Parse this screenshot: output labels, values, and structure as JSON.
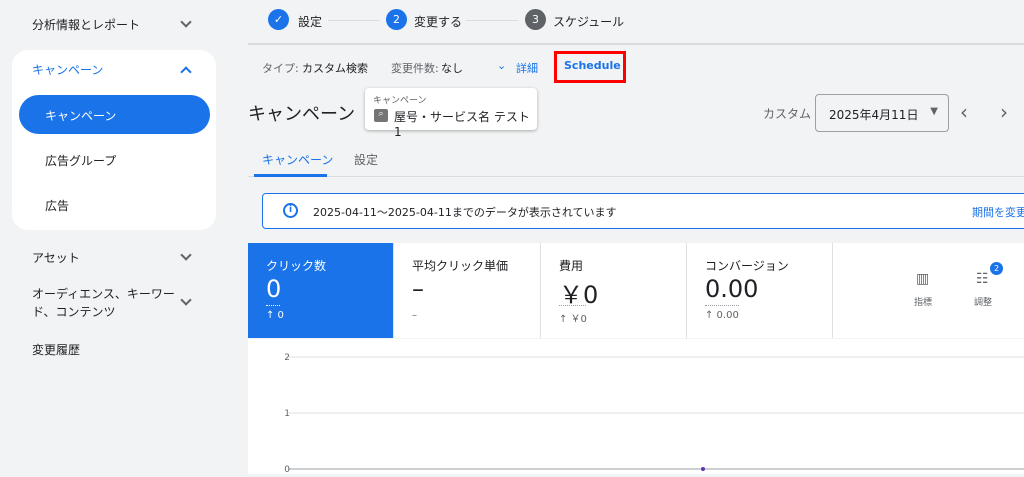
{
  "sidebar": {
    "items": [
      {
        "label": "分析情報とレポート"
      },
      {
        "label": "キャンペーン"
      },
      {
        "label": "キャンペーン",
        "selected": true
      },
      {
        "label": "広告グループ"
      },
      {
        "label": "広告"
      },
      {
        "label": "アセット"
      },
      {
        "label": "オーディエンス、キーワード、コンテンツ"
      },
      {
        "label": "変更履歴"
      }
    ]
  },
  "stepper": {
    "steps": [
      {
        "num": "✓",
        "label": "設定",
        "state": "done"
      },
      {
        "num": "2",
        "label": "変更する",
        "state": "active"
      },
      {
        "num": "3",
        "label": "スケジュール",
        "state": "pending"
      }
    ]
  },
  "infobar": {
    "type_label": "タイプ:",
    "type_value": "カスタム検索",
    "changes_label": "変更件数:",
    "changes_value": "なし",
    "details": "詳細",
    "schedule": "Schedule"
  },
  "header": {
    "title": "キャンペーン",
    "picker_label": "キャンペーン",
    "picker_value": "屋号・サービス名 テスト1",
    "range_label": "カスタム",
    "date": "2025年4月11日"
  },
  "tabs": [
    {
      "label": "キャンペーン",
      "active": true
    },
    {
      "label": "設定"
    }
  ],
  "banner": {
    "text": "2025-04-11〜2025-04-11までのデータが表示されています",
    "action": "期間を変更"
  },
  "metrics": [
    {
      "label": "クリック数",
      "value": "0",
      "sub": "↑ 0",
      "selected": true
    },
    {
      "label": "平均クリック単価",
      "value": "–",
      "sub": "–"
    },
    {
      "label": "費用",
      "value": "￥0",
      "sub": "↑ ￥0"
    },
    {
      "label": "コンバージョン",
      "value": "0.00",
      "sub": "↑ 0.00"
    }
  ],
  "tools": {
    "metrics": "指標",
    "adjust": "調整",
    "adjust_badge": "2"
  },
  "chart_data": {
    "type": "line",
    "ylim": [
      0,
      2
    ],
    "yticks": [
      "2",
      "1",
      "0"
    ],
    "series": [
      {
        "values": [
          0
        ]
      }
    ]
  },
  "colors": {
    "accent": "#1a73e8",
    "highlight_box": "#ff0000"
  }
}
